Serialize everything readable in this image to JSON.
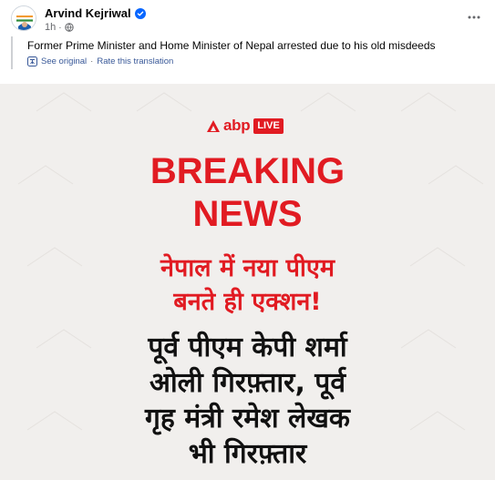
{
  "post": {
    "author": "Arvind Kejriwal",
    "time": "1h",
    "separator": "·",
    "text": "Former Prime Minister and Home Minister of Nepal arrested due to his old misdeeds",
    "see_original": "See original",
    "rate_translation": "Rate this translation",
    "translate_sep": "·"
  },
  "image": {
    "brand": "abp",
    "live_badge": "LIVE",
    "headline1": "BREAKING",
    "headline2": "NEWS",
    "hindi_line1": "नेपाल में नया पीएम",
    "hindi_line2": "बनते ही एक्शन!",
    "hindi_line3": "पूर्व पीएम केपी शर्मा",
    "hindi_line4": "ओली गिरफ़्तार, पूर्व",
    "hindi_line5": "गृह मंत्री रमेश लेखक",
    "hindi_line6": "भी गिरफ़्तार"
  },
  "colors": {
    "brand_red": "#e11b22",
    "link_blue": "#385898",
    "verified_blue": "#0866ff",
    "image_bg": "#f1efed"
  }
}
